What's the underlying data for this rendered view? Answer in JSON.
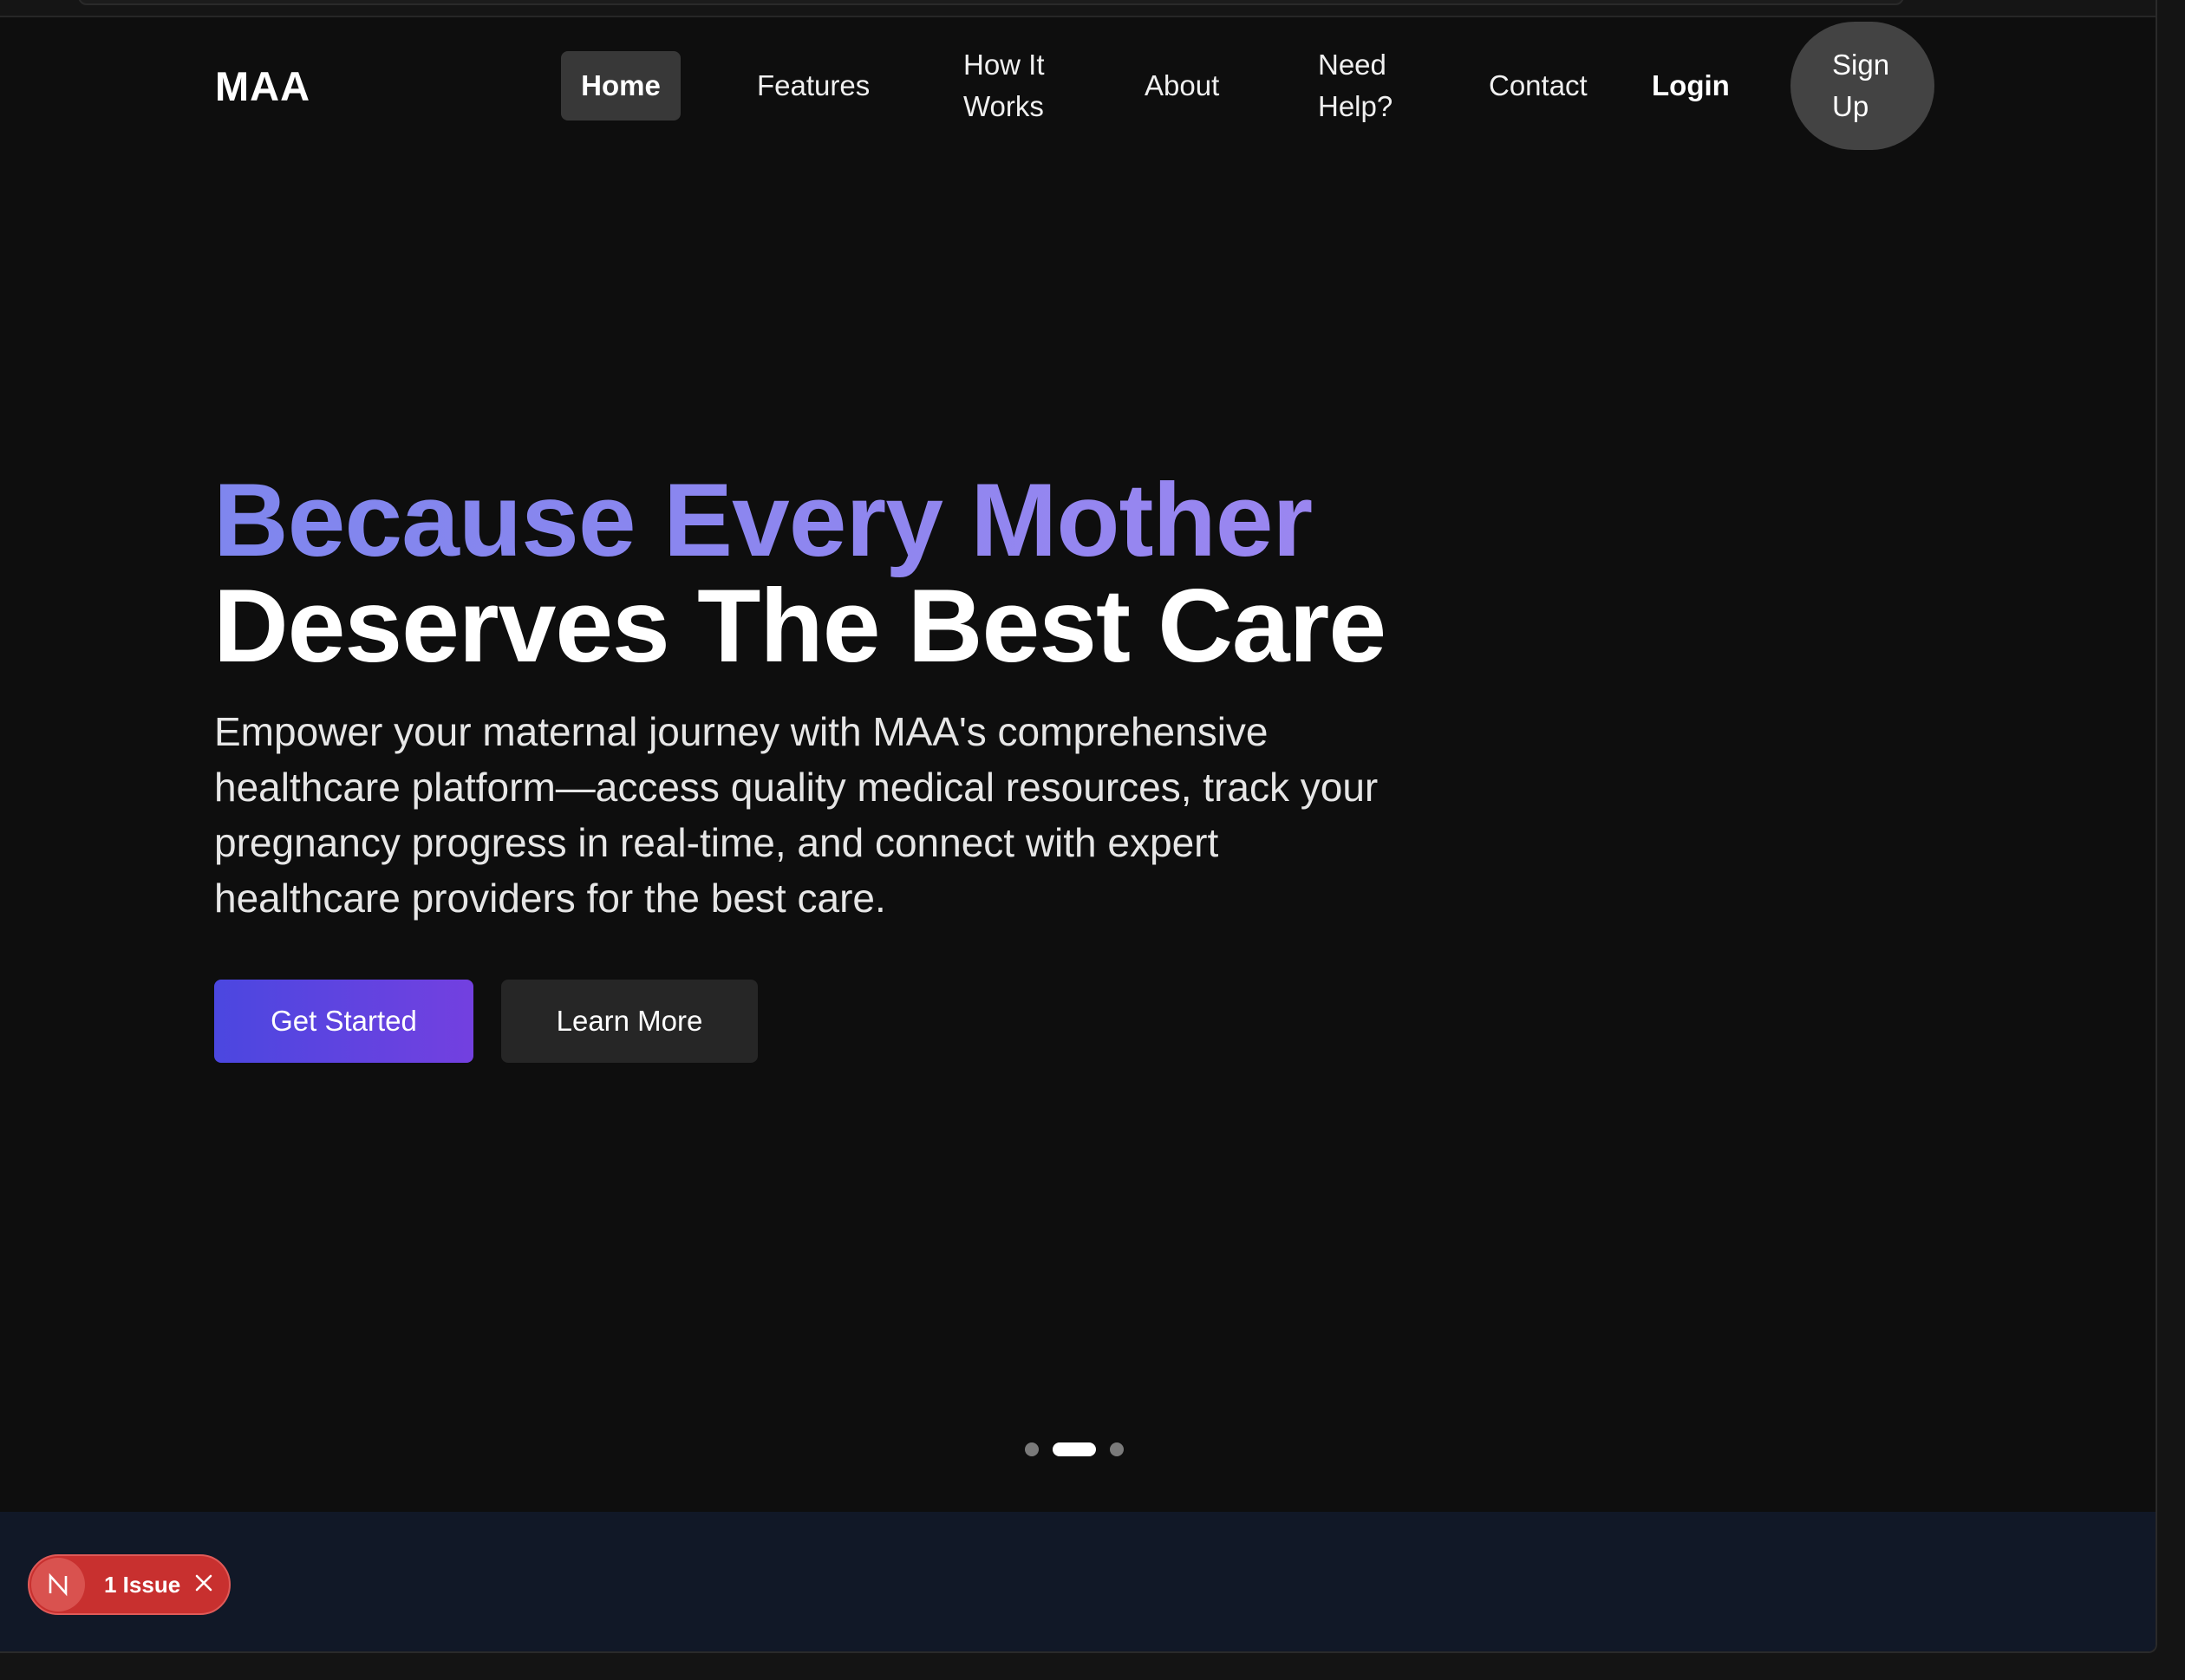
{
  "nav": {
    "logo": "MAA",
    "home": "Home",
    "features": "Features",
    "how_it_works_1": "How It",
    "how_it_works_2": "Works",
    "about": "About",
    "need_help_1": "Need",
    "need_help_2": "Help?",
    "contact": "Contact",
    "login": "Login",
    "signup_1": "Sign",
    "signup_2": "Up"
  },
  "hero": {
    "title_line1": "Because Every Mother",
    "title_line2": "Deserves The Best Care",
    "description": "Empower your maternal journey with MAA's comprehensive healthcare platform—access quality medical resources, track your pregnancy progress in real-time, and connect with expert healthcare providers for the best care.",
    "primary_button": "Get Started",
    "secondary_button": "Learn More",
    "carousel": {
      "slides": 3,
      "active_index": 1
    }
  },
  "dev_overlay": {
    "badge_icon": "nextjs-n-icon",
    "issue_label": "1 Issue",
    "close_icon": "close-icon"
  },
  "colors": {
    "background": "#0e0e0e",
    "accent_gradient_start": "#4b47e0",
    "accent_gradient_end": "#7340e0",
    "headline_gradient_start": "#7f86ee",
    "headline_gradient_end": "#9a86f0",
    "issue_badge": "#c8302f",
    "lower_section": "#111827"
  }
}
